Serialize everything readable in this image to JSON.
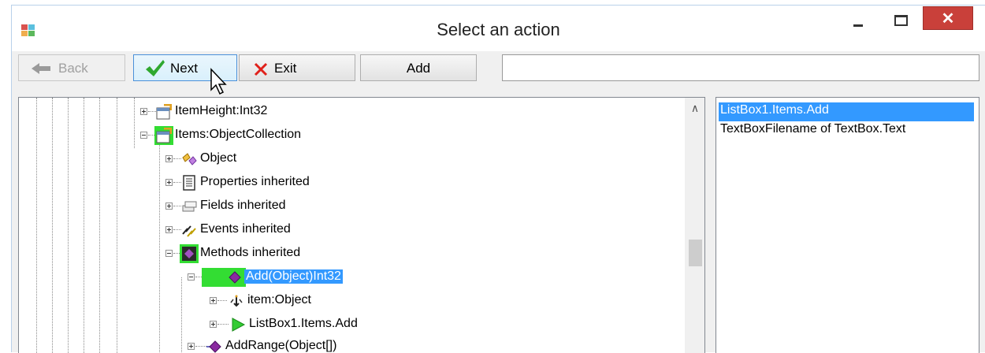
{
  "window": {
    "title": "Select an action",
    "close_glyph": "✕"
  },
  "toolbar": {
    "back_label": "Back",
    "next_label": "Next",
    "exit_label": "Exit",
    "add_label": "Add",
    "path_value": ""
  },
  "tree": {
    "nodes": [
      {
        "label": "ItemHeight:Int32",
        "icon": "property-icon"
      },
      {
        "label": "Items:ObjectCollection",
        "icon": "property-icon"
      },
      {
        "label": "Object",
        "icon": "object-icon"
      },
      {
        "label": "Properties inherited",
        "icon": "properties-icon"
      },
      {
        "label": "Fields inherited",
        "icon": "fields-icon"
      },
      {
        "label": "Events inherited",
        "icon": "events-icon"
      },
      {
        "label": "Methods inherited",
        "icon": "methods-icon"
      },
      {
        "label": "Add(Object)Int32",
        "icon": "method-icon"
      },
      {
        "label": "item:Object",
        "icon": "parameter-icon"
      },
      {
        "label": "ListBox1.Items.Add",
        "icon": "action-icon"
      },
      {
        "label": "AddRange(Object[])",
        "icon": "method-icon"
      }
    ]
  },
  "actions": {
    "items": [
      "ListBox1.Items.Add",
      "TextBoxFilename of TextBox.Text"
    ],
    "selected_index": 0
  },
  "colors": {
    "selection": "#3399ff",
    "highlight": "#33dd33",
    "close_button": "#c9403a"
  }
}
